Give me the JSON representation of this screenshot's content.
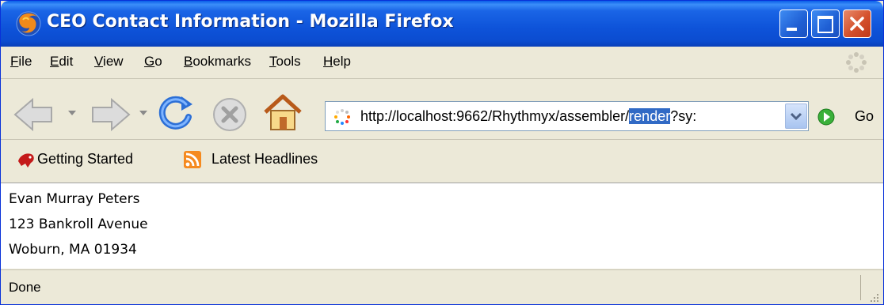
{
  "window": {
    "title": "CEO Contact Information - Mozilla Firefox",
    "controls": [
      "minimize-icon",
      "maximize-icon",
      "close-icon"
    ]
  },
  "menu": {
    "items": [
      {
        "mnemonic": "F",
        "rest": "ile"
      },
      {
        "mnemonic": "E",
        "rest": "dit"
      },
      {
        "mnemonic": "V",
        "rest": "iew"
      },
      {
        "mnemonic": "G",
        "rest": "o"
      },
      {
        "mnemonic": "B",
        "rest": "ookmarks"
      },
      {
        "mnemonic": "T",
        "rest": "ools"
      },
      {
        "mnemonic": "H",
        "rest": "elp"
      }
    ]
  },
  "navigation": {
    "buttons": [
      "back-icon",
      "forward-icon",
      "reload-icon",
      "stop-icon",
      "home-icon"
    ],
    "url_before": "http://localhost:9662/Rhythmyx/assembler/",
    "url_selected": "render",
    "url_after": "?sy:",
    "go_label": "Go"
  },
  "bookmarks": {
    "items": [
      {
        "label": "Getting Started",
        "icon": "getting-started-icon"
      },
      {
        "label": "Latest Headlines",
        "icon": "rss-feed-icon"
      }
    ]
  },
  "content": {
    "lines": [
      "Evan Murray Peters",
      "123 Bankroll Avenue",
      "Woburn, MA 01934"
    ]
  },
  "status": {
    "text": "Done"
  },
  "colors": {
    "titlebar": "#0b4cd0",
    "chrome": "#ece9d8",
    "selection": "#316ac5",
    "close_button": "#d4502c"
  }
}
